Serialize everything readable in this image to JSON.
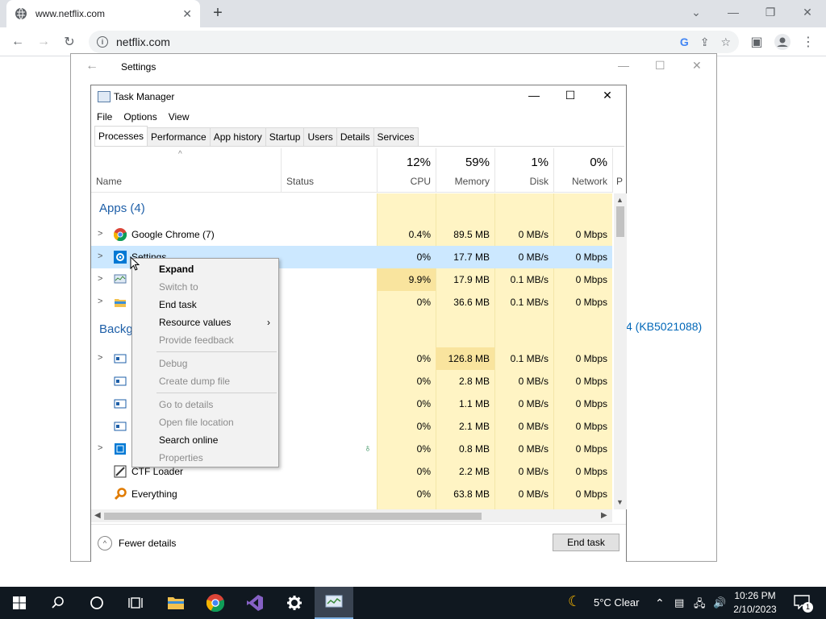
{
  "browser": {
    "tab_title": "www.netflix.com",
    "url": "netflix.com"
  },
  "settings": {
    "title": "Settings",
    "background_text": "4 (KB5021088)"
  },
  "taskmanager": {
    "title": "Task Manager",
    "menu": [
      "File",
      "Options",
      "View"
    ],
    "tabs": [
      "Processes",
      "Performance",
      "App history",
      "Startup",
      "Users",
      "Details",
      "Services"
    ],
    "columns": {
      "name": "Name",
      "status": "Status",
      "cpu_pct": "12%",
      "cpu": "CPU",
      "mem_pct": "59%",
      "mem": "Memory",
      "disk_pct": "1%",
      "disk": "Disk",
      "net_pct": "0%",
      "net": "Network",
      "power_partial": "P"
    },
    "group_apps": "Apps (4)",
    "group_background": "Backg",
    "rows": [
      {
        "name": "Google Chrome (7)",
        "cpu": "0.4%",
        "mem": "89.5 MB",
        "disk": "0 MB/s",
        "net": "0 Mbps"
      },
      {
        "name": "Settings",
        "cpu": "0%",
        "mem": "17.7 MB",
        "disk": "0 MB/s",
        "net": "0 Mbps"
      },
      {
        "name": "",
        "cpu": "9.9%",
        "mem": "17.9 MB",
        "disk": "0.1 MB/s",
        "net": "0 Mbps"
      },
      {
        "name": "",
        "cpu": "0%",
        "mem": "36.6 MB",
        "disk": "0.1 MB/s",
        "net": "0 Mbps"
      },
      {
        "name": "",
        "cpu": "0%",
        "mem": "126.8 MB",
        "disk": "0.1 MB/s",
        "net": "0 Mbps"
      },
      {
        "name": "",
        "cpu": "0%",
        "mem": "2.8 MB",
        "disk": "0 MB/s",
        "net": "0 Mbps"
      },
      {
        "name": "",
        "cpu": "0%",
        "mem": "1.1 MB",
        "disk": "0 MB/s",
        "net": "0 Mbps"
      },
      {
        "name": "",
        "cpu": "0%",
        "mem": "2.1 MB",
        "disk": "0 MB/s",
        "net": "0 Mbps"
      },
      {
        "name": "",
        "cpu": "0%",
        "mem": "0.8 MB",
        "disk": "0 MB/s",
        "net": "0 Mbps"
      },
      {
        "name": "CTF Loader",
        "cpu": "0%",
        "mem": "2.2 MB",
        "disk": "0 MB/s",
        "net": "0 Mbps"
      },
      {
        "name": "Everything",
        "cpu": "0%",
        "mem": "63.8 MB",
        "disk": "0 MB/s",
        "net": "0 Mbps"
      }
    ],
    "fewer_details": "Fewer details",
    "end_task": "End task"
  },
  "context_menu": {
    "expand": "Expand",
    "switch_to": "Switch to",
    "end_task": "End task",
    "resource_values": "Resource values",
    "provide_feedback": "Provide feedback",
    "debug": "Debug",
    "create_dump": "Create dump file",
    "go_to_details": "Go to details",
    "open_file_location": "Open file location",
    "search_online": "Search online",
    "properties": "Properties"
  },
  "taskbar": {
    "weather": "5°C  Clear",
    "time": "10:26 PM",
    "date": "2/10/2023",
    "notif_count": "1"
  },
  "colors": {
    "accent": "#0067b8",
    "heat": "#fff4c4",
    "selection": "#cce8ff",
    "taskbar": "#101820"
  }
}
